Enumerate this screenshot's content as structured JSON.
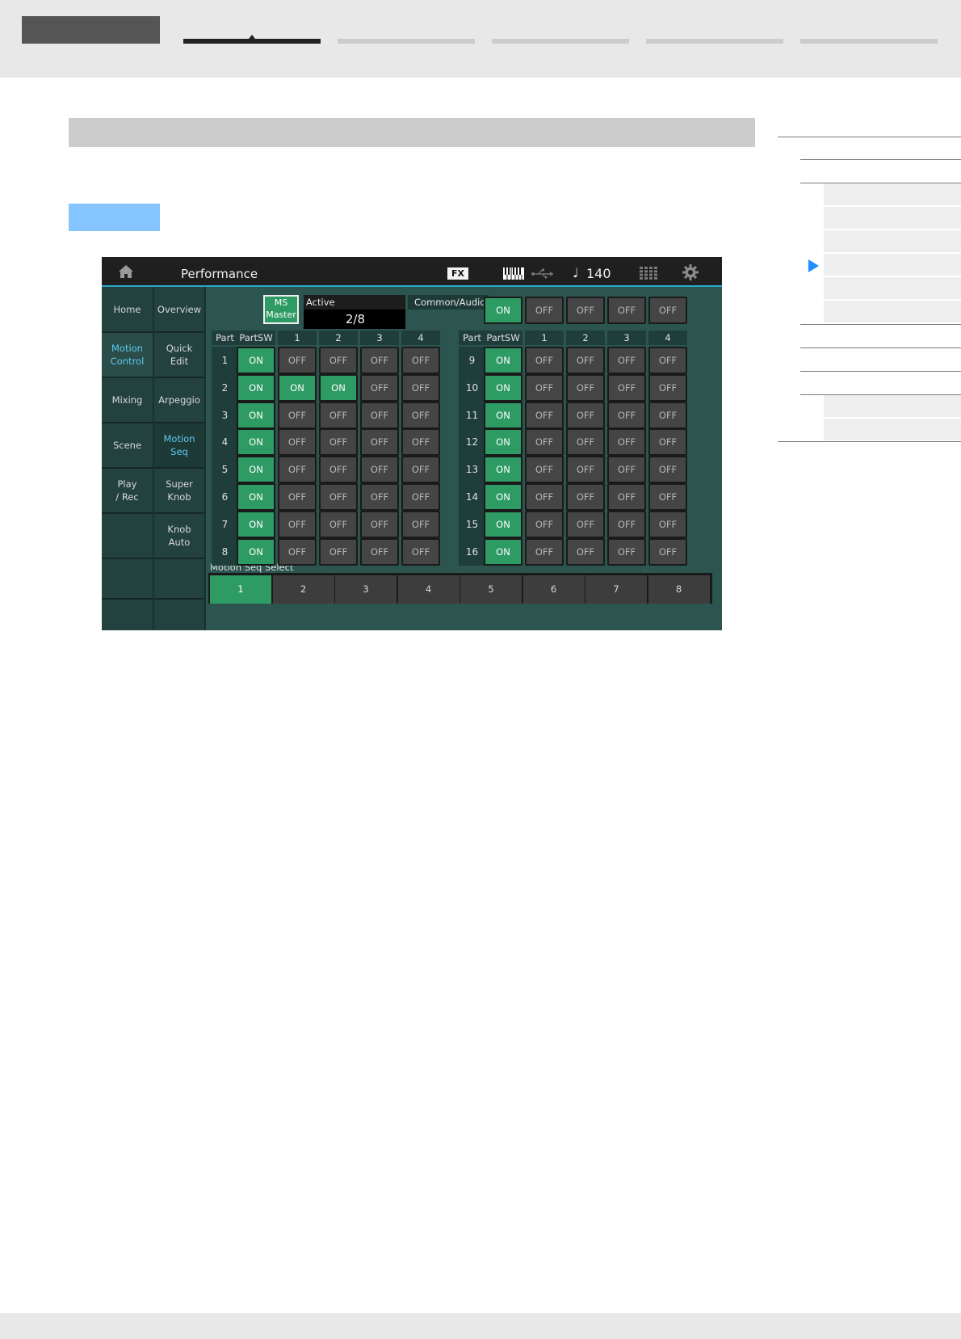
{
  "screen": {
    "title": "Performance",
    "fx_badge": "FX",
    "tempo_note": "♩",
    "tempo": "140",
    "nav_primary": [
      {
        "label": "Home",
        "selected": false
      },
      {
        "label": "Motion\nControl",
        "selected": true
      },
      {
        "label": "Mixing",
        "selected": false
      },
      {
        "label": "Scene",
        "selected": false
      },
      {
        "label": "Play\n/ Rec",
        "selected": false
      },
      {
        "label": "",
        "selected": false
      },
      {
        "label": "",
        "selected": false
      }
    ],
    "nav_secondary": [
      {
        "label": "Overview",
        "selected": false
      },
      {
        "label": "Quick\nEdit",
        "selected": false
      },
      {
        "label": "Arpeggio",
        "selected": false
      },
      {
        "label": "Motion\nSeq",
        "selected": true
      },
      {
        "label": "Super\nKnob",
        "selected": false
      },
      {
        "label": "Knob\nAuto",
        "selected": false
      },
      {
        "label": "",
        "selected": false
      }
    ],
    "ms_master": "MS\nMaster",
    "active_label": "Active",
    "active_value": "2/8",
    "common_audio_label": "Common/Audio",
    "common_audio_switches": [
      "ON",
      "OFF",
      "OFF",
      "OFF",
      "OFF"
    ],
    "column_headers": [
      "Part",
      "PartSW",
      "1",
      "2",
      "3",
      "4"
    ],
    "parts_left": [
      {
        "part": "1",
        "switches": [
          "ON",
          "OFF",
          "OFF",
          "OFF",
          "OFF"
        ]
      },
      {
        "part": "2",
        "switches": [
          "ON",
          "ON",
          "ON",
          "OFF",
          "OFF"
        ]
      },
      {
        "part": "3",
        "switches": [
          "ON",
          "OFF",
          "OFF",
          "OFF",
          "OFF"
        ]
      },
      {
        "part": "4",
        "switches": [
          "ON",
          "OFF",
          "OFF",
          "OFF",
          "OFF"
        ]
      },
      {
        "part": "5",
        "switches": [
          "ON",
          "OFF",
          "OFF",
          "OFF",
          "OFF"
        ]
      },
      {
        "part": "6",
        "switches": [
          "ON",
          "OFF",
          "OFF",
          "OFF",
          "OFF"
        ]
      },
      {
        "part": "7",
        "switches": [
          "ON",
          "OFF",
          "OFF",
          "OFF",
          "OFF"
        ]
      },
      {
        "part": "8",
        "switches": [
          "ON",
          "OFF",
          "OFF",
          "OFF",
          "OFF"
        ]
      }
    ],
    "parts_right": [
      {
        "part": "9",
        "switches": [
          "ON",
          "OFF",
          "OFF",
          "OFF",
          "OFF"
        ]
      },
      {
        "part": "10",
        "switches": [
          "ON",
          "OFF",
          "OFF",
          "OFF",
          "OFF"
        ]
      },
      {
        "part": "11",
        "switches": [
          "ON",
          "OFF",
          "OFF",
          "OFF",
          "OFF"
        ]
      },
      {
        "part": "12",
        "switches": [
          "ON",
          "OFF",
          "OFF",
          "OFF",
          "OFF"
        ]
      },
      {
        "part": "13",
        "switches": [
          "ON",
          "OFF",
          "OFF",
          "OFF",
          "OFF"
        ]
      },
      {
        "part": "14",
        "switches": [
          "ON",
          "OFF",
          "OFF",
          "OFF",
          "OFF"
        ]
      },
      {
        "part": "15",
        "switches": [
          "ON",
          "OFF",
          "OFF",
          "OFF",
          "OFF"
        ]
      },
      {
        "part": "16",
        "switches": [
          "ON",
          "OFF",
          "OFF",
          "OFF",
          "OFF"
        ]
      }
    ],
    "motion_seq_select_label": "Motion Seq Select",
    "motion_seq_select": [
      "1",
      "2",
      "3",
      "4",
      "5",
      "6",
      "7",
      "8"
    ],
    "motion_seq_selected_index": 0
  },
  "colors": {
    "on": "#2e9a64",
    "off": "#454545",
    "selected_nav_text": "#5ec8f0",
    "toc_arrow": "#1e90ff",
    "page_chrome": "#e8e8e8"
  },
  "icons": [
    "home-icon",
    "keyboard-icon",
    "usb-icon",
    "quarter-note-icon",
    "grid-icon",
    "gear-icon",
    "toc-current-arrow-icon"
  ]
}
